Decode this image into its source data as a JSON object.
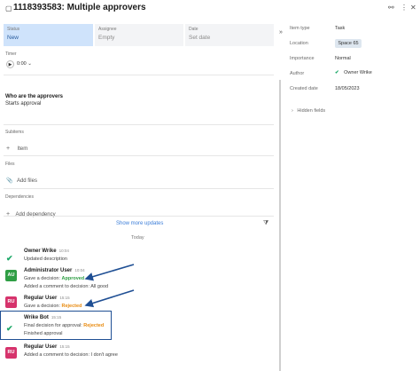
{
  "header": {
    "task_id": "1118393583",
    "title_text": "1118393583: Multiple approvers",
    "link_icon": "link-icon",
    "more_icon": "more-icon",
    "close_icon": "close-icon"
  },
  "status_row": {
    "status_label": "Status",
    "status_value": "New",
    "assignee_label": "Assignee",
    "assignee_value": "Empty",
    "date_label": "Date",
    "date_value": "Set date"
  },
  "collapse_label": "»",
  "timer": {
    "label": "Timer",
    "value": "0:00"
  },
  "approvers": {
    "heading": "Who are the approvers",
    "text": "Starts approval"
  },
  "subitems": {
    "label": "Subitems",
    "add_label": "Item"
  },
  "files": {
    "label": "Files",
    "add_label": "Add files"
  },
  "dependencies": {
    "label": "Dependencies",
    "add_label": "Add dependency"
  },
  "right_panel": {
    "item_type_label": "Item type",
    "item_type_value": "Task",
    "location_label": "Location",
    "location_value": "Space 65",
    "importance_label": "Importance",
    "importance_value": "Normal",
    "author_label": "Author",
    "author_value": "Owner Wrike",
    "created_label": "Created date",
    "created_value": "18/05/2023",
    "hidden_fields_label": "Hidden fields"
  },
  "stream": {
    "show_more": "Show more updates",
    "today": "Today",
    "items": [
      {
        "name": "Owner Wrike",
        "time": "10:04",
        "line1": "Updated description"
      },
      {
        "avatar": "AU",
        "name": "Administrator User",
        "time": "10:04",
        "line1_prefix": "Gave a decision: ",
        "line1_decision": "Approved",
        "line2": "Added a comment to decision: All good"
      },
      {
        "avatar": "RU",
        "name": "Regular User",
        "time": "15:15",
        "line1_prefix": "Gave a decision: ",
        "line1_decision": "Rejected"
      },
      {
        "name": "Wrike Bot",
        "time": "15:15",
        "line1_prefix": "Final decision for approval: ",
        "line1_decision": "Rejected",
        "line2": "Finished approval"
      },
      {
        "avatar": "RU",
        "name": "Regular User",
        "time": "15:15",
        "line1": "Added a comment to decision: I don't agree"
      }
    ]
  },
  "colors": {
    "accent": "#3b7dd8",
    "status_bg": "#cfe3fb",
    "approved": "#2f9e44",
    "rejected": "#e8890c",
    "highlight_border": "#1f4f94"
  }
}
